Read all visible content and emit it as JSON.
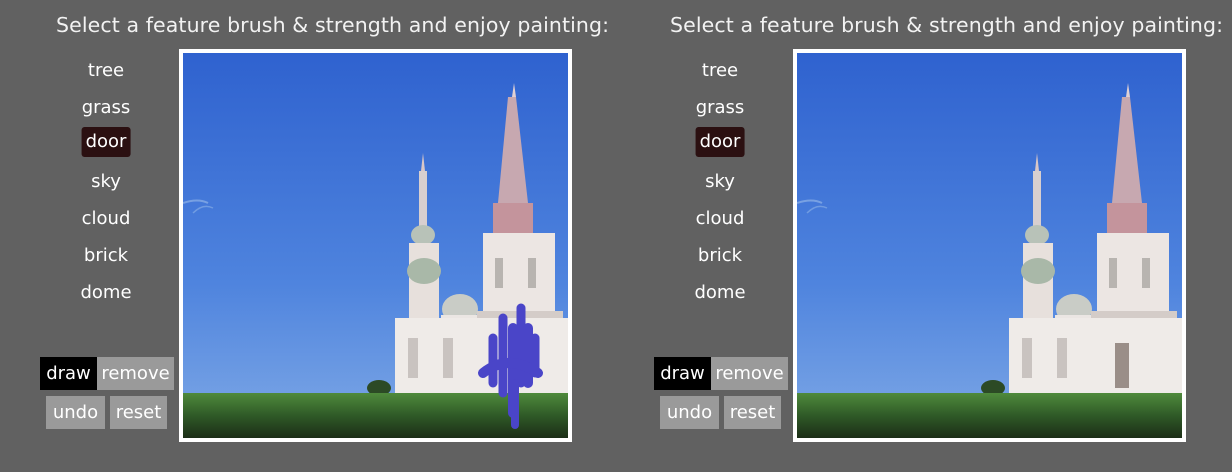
{
  "left_panel": {
    "title": "Select a feature brush & strength and enjoy painting:",
    "features": [
      "tree",
      "grass",
      "door",
      "sky",
      "cloud",
      "brick",
      "dome"
    ],
    "selected_feature": "door",
    "modes": {
      "draw": "draw",
      "remove": "remove"
    },
    "active_mode": "draw",
    "actions": {
      "undo": "undo",
      "reset": "reset"
    }
  },
  "right_panel": {
    "title": "Select a feature brush & strength and enjoy painting:",
    "features": [
      "tree",
      "grass",
      "door",
      "sky",
      "cloud",
      "brick",
      "dome"
    ],
    "selected_feature": "door",
    "modes": {
      "draw": "draw",
      "remove": "remove"
    },
    "active_mode": "draw",
    "actions": {
      "undo": "undo",
      "reset": "reset"
    }
  },
  "colors": {
    "background": "#616161",
    "selected_feature": "#2b1011",
    "active_mode": "#000000",
    "button": "#9a9a9a",
    "brush_stroke": "#4a45c8"
  }
}
